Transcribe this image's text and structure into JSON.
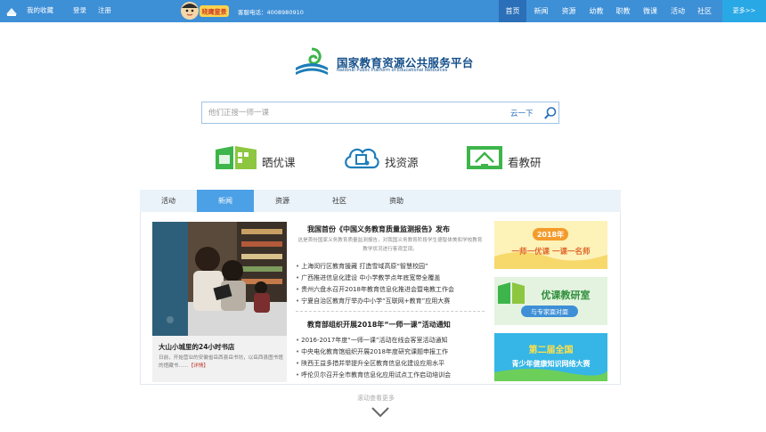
{
  "topbar": {
    "favorites": "我的收藏",
    "login": "登录",
    "register": "注册",
    "mascot_text": "晓鹰童景",
    "phone": "客服电话：4008980910",
    "nav": [
      "首页",
      "新闻",
      "资源",
      "幼教",
      "职教",
      "微课",
      "活动",
      "社区"
    ],
    "active_nav": "首页",
    "more": "更多>>"
  },
  "brand": {
    "name_cn": "国家教育资源公共服务平台",
    "name_en": "National Public Platform of Educational Resources"
  },
  "search": {
    "placeholder": "他们正搜一师一课",
    "button": "云一下"
  },
  "features": [
    {
      "label": "晒优课"
    },
    {
      "label": "找资源"
    },
    {
      "label": "看教研"
    }
  ],
  "tabs": [
    "活动",
    "新闻",
    "资源",
    "社区",
    "资助"
  ],
  "active_tab": "新闻",
  "story": {
    "title": "大山小城里的24小时书店",
    "desc": "日前，开始营业的安徽省岳西县岳书坊，以岳西县图书馆的馆藏书……",
    "more": "【详情】"
  },
  "news": {
    "headline1": "我国首份《中国义务教育质量监测报告》发布",
    "summary1": "这是首份国家义务教育质量监测报告，对我国义务教育阶段学生德智体美和学校教育教学状况进行客观呈现。",
    "items1": [
      "上海闵行区教育援藏  打造雪域高原“智慧校园”",
      "广西推进信息化建设  中小学教学点年底宽带全覆盖",
      "贵州六盘水召开2018年教育信息化推进会暨电教工作会",
      "宁夏自治区教育厅举办中小学“互联网+教育”应用大赛"
    ],
    "headline2": "教育部组织开展2018年“一师一课”活动通知",
    "items2": [
      "2016-2017年度“一师一课”活动在线会客室活动通知",
      "中央电化教育馆组织开展2018年度研究课题申报工作",
      "陕西王益多措并举提升全区教育信息化建设应用水平",
      "呼伦贝尔召开全市教育信息化应用试点工作启动培训会"
    ]
  },
  "banners": [
    {
      "year": "2018年",
      "text": "一师一优课 一课一名师"
    },
    {
      "text": "优课教研室",
      "sub": "与专家面对面"
    },
    {
      "text": "第二届全国",
      "sub": "青少年健康知识网络大赛"
    }
  ],
  "scroll_hint": "滚动查看更多",
  "colors": {
    "primary": "#3d8fd6",
    "active_tab": "#4ba0e6",
    "accent_green": "#3db54a"
  }
}
